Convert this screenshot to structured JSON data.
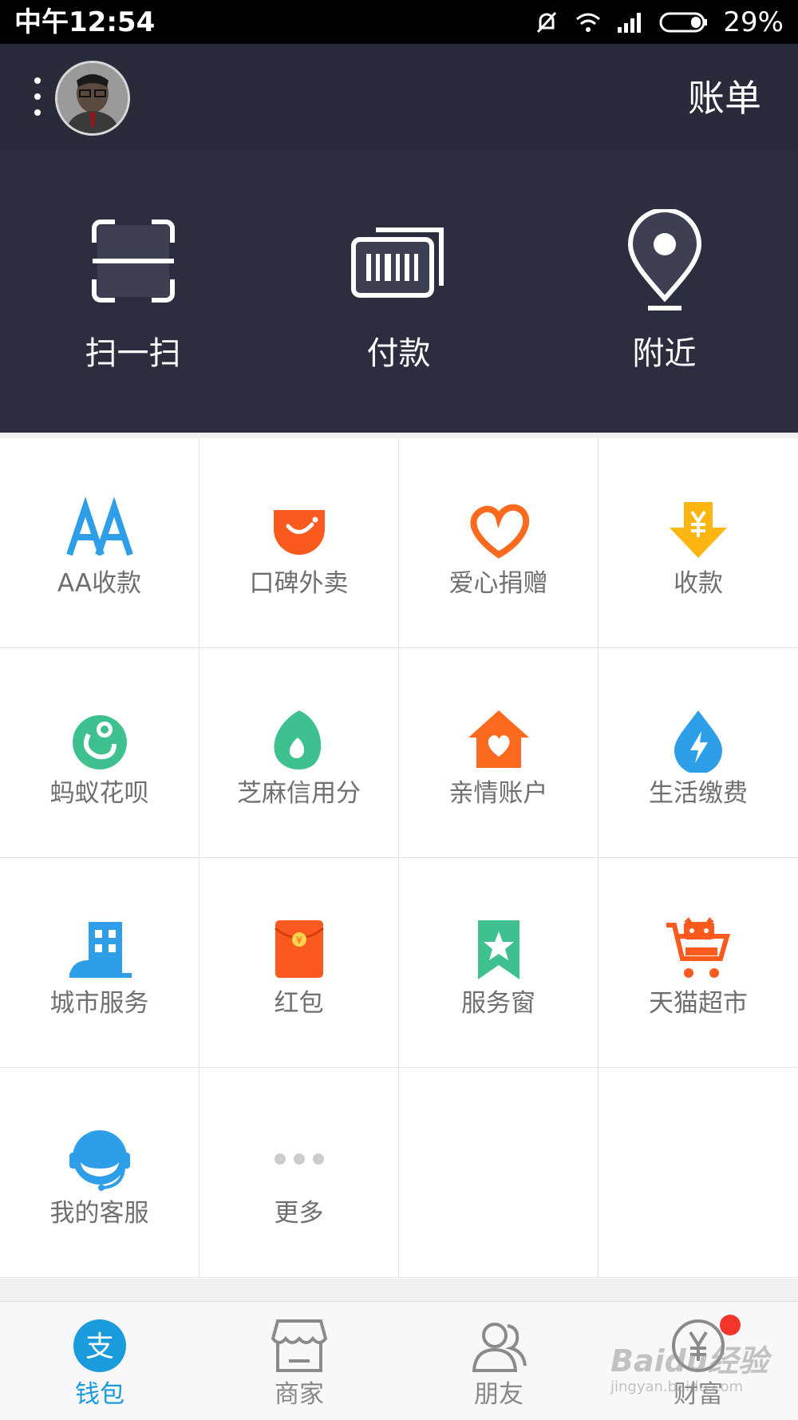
{
  "status_bar": {
    "time": "中午12:54",
    "battery": "29%"
  },
  "header": {
    "bill_label": "账单",
    "menu_icon": "more-vertical-icon",
    "avatar": "user-avatar"
  },
  "quick_actions": [
    {
      "label": "扫一扫",
      "icon": "scan-icon"
    },
    {
      "label": "付款",
      "icon": "barcode-pay-icon"
    },
    {
      "label": "附近",
      "icon": "location-pin-icon"
    }
  ],
  "services": [
    {
      "label": "AA收款",
      "icon": "aa-icon",
      "color": "#2f9ee8"
    },
    {
      "label": "口碑外卖",
      "icon": "koubei-smile-icon",
      "color": "#fb5a1f"
    },
    {
      "label": "爱心捐赠",
      "icon": "heart-icon",
      "color": "#fb6a1f"
    },
    {
      "label": "收款",
      "icon": "yuan-arrow-icon",
      "color": "#fcb511"
    },
    {
      "label": "蚂蚁花呗",
      "icon": "huabei-icon",
      "color": "#3fc08f"
    },
    {
      "label": "芝麻信用分",
      "icon": "sesame-icon",
      "color": "#3fc08f"
    },
    {
      "label": "亲情账户",
      "icon": "home-heart-icon",
      "color": "#fb6a1f"
    },
    {
      "label": "生活缴费",
      "icon": "bolt-drop-icon",
      "color": "#2f9ee8"
    },
    {
      "label": "城市服务",
      "icon": "city-building-icon",
      "color": "#2f9ee8"
    },
    {
      "label": "红包",
      "icon": "red-envelope-icon",
      "color": "#fb5a1f"
    },
    {
      "label": "服务窗",
      "icon": "star-bookmark-icon",
      "color": "#3fc08f"
    },
    {
      "label": "天猫超市",
      "icon": "tmall-cart-icon",
      "color": "#fb5a1f"
    },
    {
      "label": "我的客服",
      "icon": "headset-icon",
      "color": "#2f9ee8"
    },
    {
      "label": "更多",
      "icon": "more-dots-icon",
      "color": "#cccccc"
    }
  ],
  "tabs": [
    {
      "label": "钱包",
      "icon": "alipay-icon",
      "active": true
    },
    {
      "label": "商家",
      "icon": "store-icon",
      "active": false
    },
    {
      "label": "朋友",
      "icon": "friends-icon",
      "active": false
    },
    {
      "label": "财富",
      "icon": "wealth-icon",
      "active": false,
      "badge": true
    }
  ],
  "watermark": {
    "line1": "Baidu经验",
    "line2": "jingyan.baidu.com"
  },
  "colors": {
    "header_bg": "#282b3a",
    "quick_bg": "#2b2e3f",
    "active_tab": "#1a9bdb",
    "badge": "#f2352b"
  }
}
